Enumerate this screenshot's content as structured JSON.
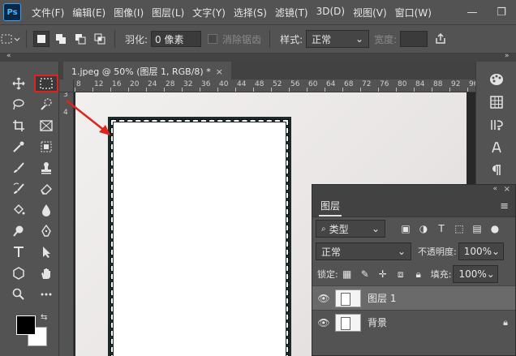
{
  "app": {
    "logo": "Ps"
  },
  "menu": [
    "文件(F)",
    "编辑(E)",
    "图像(I)",
    "图层(L)",
    "文字(Y)",
    "选择(S)",
    "滤镜(T)",
    "3D(D)",
    "视图(V)",
    "窗口(W)"
  ],
  "window_controls": {
    "minimize": "—",
    "maximize": "❐"
  },
  "options": {
    "feather_label": "羽化:",
    "feather_value": "0 像素",
    "antialias_label": "消除锯齿",
    "style_label": "样式:",
    "style_value": "正常",
    "width_label": "宽度:"
  },
  "document": {
    "tab_title": "1.jpeg @ 50% (图层 1, RGB/8) *",
    "close": "×"
  },
  "ruler": {
    "h_ticks": [
      "8",
      "12",
      "16",
      "20",
      "24",
      "28",
      "32",
      "36",
      "40",
      "44",
      "48",
      "52",
      "56",
      "60",
      "64",
      "68",
      "72",
      "76",
      "80",
      "84",
      "88",
      "92",
      "96"
    ],
    "v_ticks": [
      "3",
      "4"
    ]
  },
  "layers_panel": {
    "tab_label": "图层",
    "filter_label": "类型",
    "blend_mode": "正常",
    "opacity_label": "不透明度:",
    "opacity_value": "100%",
    "lock_label": "锁定:",
    "fill_label": "填充:",
    "fill_value": "100%",
    "layers": [
      {
        "name": "图层 1",
        "active": true
      },
      {
        "name": "背景",
        "active": false,
        "locked": true
      }
    ]
  },
  "colors": {
    "accent_red": "#e0231c",
    "foreground": "#000000",
    "background": "#ffffff"
  }
}
